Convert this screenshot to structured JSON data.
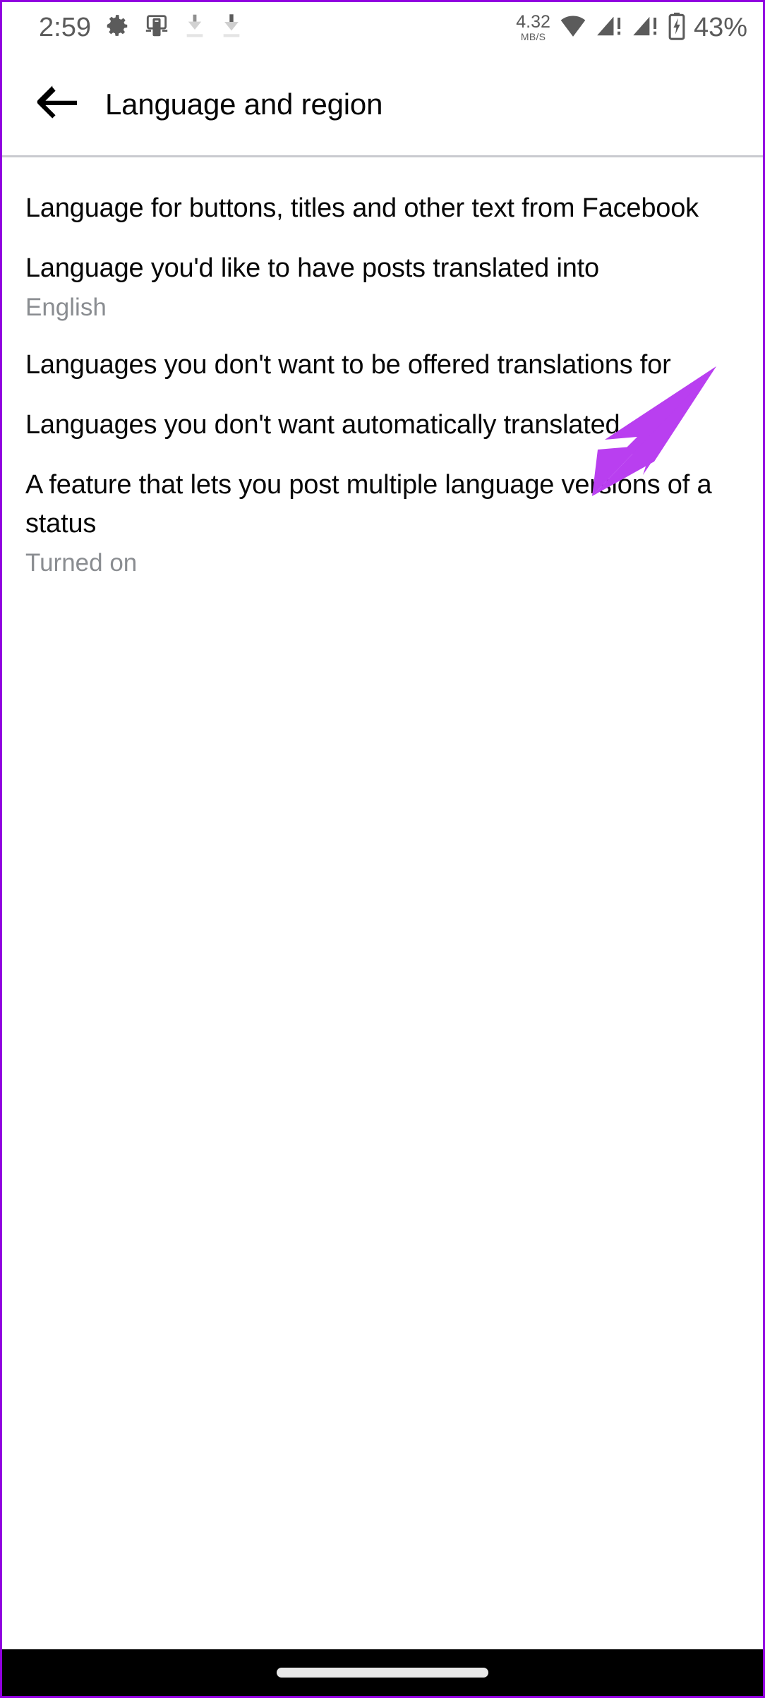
{
  "theme": {
    "frame_border_color": "#9100E0",
    "accent_arrow_color": "#B93FF0",
    "background": "#FFFFFF",
    "primary_text_color": "#080808",
    "secondary_text_color": "#8A8D91",
    "divider_color": "#C9CACF",
    "nav_bar_color": "#000000"
  },
  "status_bar": {
    "time": "2:59",
    "icons_left": [
      "gear-icon",
      "screen-cast-icon",
      "download-icon-faded",
      "download-icon"
    ],
    "network_speed_value": "4.32",
    "network_speed_unit": "MB/S",
    "icons_right": [
      "wifi-icon",
      "signal-sim1-alert-icon",
      "signal-sim2-alert-icon",
      "battery-charging-icon"
    ],
    "battery_percent": "43%"
  },
  "header": {
    "back_icon": "arrow-left-icon",
    "title": "Language and region"
  },
  "list": {
    "items": [
      {
        "title": "Language for buttons, titles and other text from Facebook",
        "subtitle": ""
      },
      {
        "title": "Language you'd like to have posts translated into",
        "subtitle": "English"
      },
      {
        "title": "Languages you don't want to be offered translations for",
        "subtitle": ""
      },
      {
        "title": "Languages you don't want automatically translated",
        "subtitle": ""
      },
      {
        "title": "A feature that lets you post multiple language versions of a status",
        "subtitle": "Turned on"
      }
    ]
  },
  "annotation": {
    "type": "arrow",
    "color": "#B93FF0",
    "points_to": "Languages you don't want automatically translated"
  },
  "nav_bar": {
    "home_indicator": "home-pill-indicator"
  }
}
